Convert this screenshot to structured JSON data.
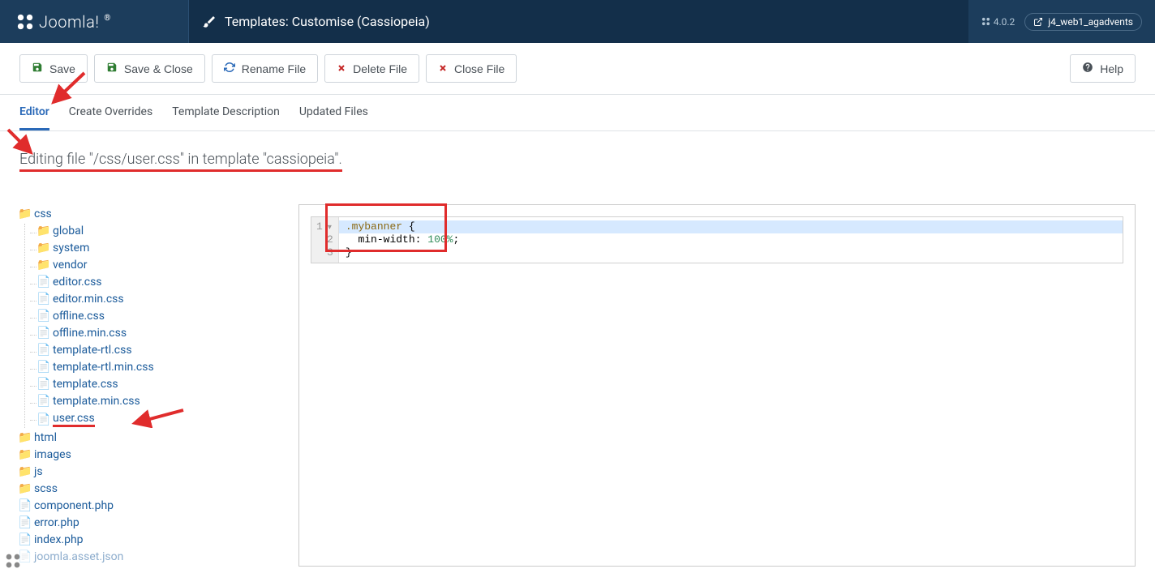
{
  "header": {
    "logo_text": "Joomla!",
    "title": "Templates: Customise (Cassiopeia)",
    "version": "4.0.2",
    "site_name": "j4_web1_agadvents"
  },
  "toolbar": {
    "save": "Save",
    "save_close": "Save & Close",
    "rename": "Rename File",
    "delete": "Delete File",
    "close": "Close File",
    "help": "Help"
  },
  "tabs": {
    "editor": "Editor",
    "create_overrides": "Create Overrides",
    "template_description": "Template Description",
    "updated_files": "Updated Files"
  },
  "editing_title": "Editing file \"/css/user.css\" in template \"cassiopeia\".",
  "tree": {
    "css": "css",
    "css_children": {
      "global": "global",
      "system": "system",
      "vendor": "vendor",
      "editor_css": "editor.css",
      "editor_min_css": "editor.min.css",
      "offline_css": "offline.css",
      "offline_min_css": "offline.min.css",
      "template_rtl_css": "template-rtl.css",
      "template_rtl_min_css": "template-rtl.min.css",
      "template_css": "template.css",
      "template_min_css": "template.min.css",
      "user_css": "user.css"
    },
    "html": "html",
    "images": "images",
    "js": "js",
    "scss": "scss",
    "component_php": "component.php",
    "error_php": "error.php",
    "index_php": "index.php",
    "joomla_asset_json": "joomla.asset.json"
  },
  "code": {
    "line1_sel": ".mybanner",
    "line1_brace": " {",
    "line2_prop": "min-width",
    "line2_colon": ": ",
    "line2_val": "100%",
    "line2_semi": ";",
    "line3_brace": "}",
    "gutter": [
      "1",
      "2",
      "3"
    ]
  }
}
